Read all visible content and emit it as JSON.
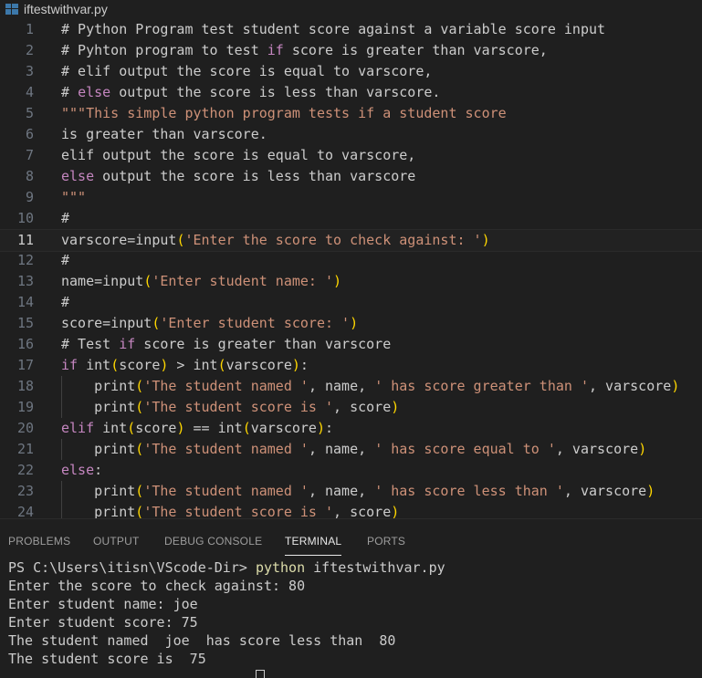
{
  "tab": {
    "filename": "iftestwithvar.py"
  },
  "editor": {
    "current_line": 11,
    "lines": [
      {
        "n": 1,
        "segs": [
          [
            "cm",
            "# Python Program test student score against a variable score input"
          ]
        ]
      },
      {
        "n": 2,
        "segs": [
          [
            "cm",
            "# Pyhton program to test "
          ],
          [
            "kw",
            "if"
          ],
          [
            "cm",
            " score is greater than varscore,"
          ]
        ]
      },
      {
        "n": 3,
        "segs": [
          [
            "cm",
            "# elif output the score is equal to varscore,"
          ]
        ]
      },
      {
        "n": 4,
        "segs": [
          [
            "cm",
            "# "
          ],
          [
            "kw",
            "else"
          ],
          [
            "cm",
            " output the score is less than varscore."
          ]
        ]
      },
      {
        "n": 5,
        "segs": [
          [
            "str",
            "\"\"\"This simple python program tests if a student score"
          ]
        ]
      },
      {
        "n": 6,
        "segs": [
          [
            "c",
            "is greater than varscore."
          ]
        ]
      },
      {
        "n": 7,
        "segs": [
          [
            "c",
            "elif output the score is equal to varscore,"
          ]
        ]
      },
      {
        "n": 8,
        "segs": [
          [
            "kw",
            "else"
          ],
          [
            "c",
            " output the score is less than varscore"
          ]
        ]
      },
      {
        "n": 9,
        "segs": [
          [
            "str",
            "\"\"\""
          ]
        ]
      },
      {
        "n": 10,
        "segs": [
          [
            "cm",
            "#"
          ]
        ]
      },
      {
        "n": 11,
        "segs": [
          [
            "c",
            "varscore=input"
          ],
          [
            "p1",
            "("
          ],
          [
            "str",
            "'Enter the score to check against: '"
          ],
          [
            "p1",
            ")"
          ]
        ]
      },
      {
        "n": 12,
        "segs": [
          [
            "cm",
            "#"
          ]
        ]
      },
      {
        "n": 13,
        "segs": [
          [
            "c",
            "name=input"
          ],
          [
            "p1",
            "("
          ],
          [
            "str",
            "'Enter student name: '"
          ],
          [
            "p1",
            ")"
          ]
        ]
      },
      {
        "n": 14,
        "segs": [
          [
            "cm",
            "#"
          ]
        ]
      },
      {
        "n": 15,
        "segs": [
          [
            "c",
            "score=input"
          ],
          [
            "p1",
            "("
          ],
          [
            "str",
            "'Enter student score: '"
          ],
          [
            "p1",
            ")"
          ]
        ]
      },
      {
        "n": 16,
        "segs": [
          [
            "cm",
            "# Test "
          ],
          [
            "kw",
            "if"
          ],
          [
            "cm",
            " score is greater than varscore"
          ]
        ]
      },
      {
        "n": 17,
        "segs": [
          [
            "kw",
            "if"
          ],
          [
            "c",
            " int"
          ],
          [
            "p1",
            "("
          ],
          [
            "c",
            "score"
          ],
          [
            "p1",
            ")"
          ],
          [
            "c",
            " > int"
          ],
          [
            "p1",
            "("
          ],
          [
            "c",
            "varscore"
          ],
          [
            "p1",
            ")"
          ],
          [
            "c",
            ":"
          ]
        ]
      },
      {
        "n": 18,
        "indent": true,
        "segs": [
          [
            "c",
            "    print"
          ],
          [
            "p1",
            "("
          ],
          [
            "str",
            "'The student named '"
          ],
          [
            "c",
            ", name, "
          ],
          [
            "str",
            "' has score greater than '"
          ],
          [
            "c",
            ", varscore"
          ],
          [
            "p1",
            ")"
          ]
        ]
      },
      {
        "n": 19,
        "indent": true,
        "segs": [
          [
            "c",
            "    print"
          ],
          [
            "p1",
            "("
          ],
          [
            "str",
            "'The student score is '"
          ],
          [
            "c",
            ", score"
          ],
          [
            "p1",
            ")"
          ]
        ]
      },
      {
        "n": 20,
        "segs": [
          [
            "kw",
            "elif"
          ],
          [
            "c",
            " int"
          ],
          [
            "p1",
            "("
          ],
          [
            "c",
            "score"
          ],
          [
            "p1",
            ")"
          ],
          [
            "c",
            " == int"
          ],
          [
            "p1",
            "("
          ],
          [
            "c",
            "varscore"
          ],
          [
            "p1",
            ")"
          ],
          [
            "c",
            ":"
          ]
        ]
      },
      {
        "n": 21,
        "indent": true,
        "segs": [
          [
            "c",
            "    print"
          ],
          [
            "p1",
            "("
          ],
          [
            "str",
            "'The student named '"
          ],
          [
            "c",
            ", name, "
          ],
          [
            "str",
            "' has score equal to '"
          ],
          [
            "c",
            ", varscore"
          ],
          [
            "p1",
            ")"
          ]
        ]
      },
      {
        "n": 22,
        "segs": [
          [
            "kw",
            "else"
          ],
          [
            "c",
            ":"
          ]
        ]
      },
      {
        "n": 23,
        "indent": true,
        "segs": [
          [
            "c",
            "    print"
          ],
          [
            "p1",
            "("
          ],
          [
            "str",
            "'The student named '"
          ],
          [
            "c",
            ", name, "
          ],
          [
            "str",
            "' has score less than '"
          ],
          [
            "c",
            ", varscore"
          ],
          [
            "p1",
            ")"
          ]
        ]
      },
      {
        "n": 24,
        "indent": true,
        "segs": [
          [
            "c",
            "    print"
          ],
          [
            "p1",
            "("
          ],
          [
            "str",
            "'The student score is '"
          ],
          [
            "c",
            ", score"
          ],
          [
            "p1",
            ")"
          ]
        ]
      }
    ]
  },
  "panel": {
    "tabs": [
      {
        "label": "PROBLEMS",
        "active": false
      },
      {
        "label": "OUTPUT",
        "active": false
      },
      {
        "label": "DEBUG CONSOLE",
        "active": false
      },
      {
        "label": "TERMINAL",
        "active": true
      },
      {
        "label": "PORTS",
        "active": false
      }
    ]
  },
  "terminal": {
    "prompt": "PS C:\\Users\\itisn\\VScode-Dir> ",
    "command": "python",
    "command_arg": " iftestwithvar.py",
    "output": [
      "Enter the score to check against: 80",
      "Enter student name: joe",
      "Enter student score: 75",
      "The student named  joe  has score less than  80",
      "The student score is  75"
    ]
  },
  "colors": {
    "background": "#1f1f1f",
    "keyword": "#c586c0",
    "string": "#ce9178",
    "bracket": "#ffd700",
    "command": "#dcdcaa"
  }
}
